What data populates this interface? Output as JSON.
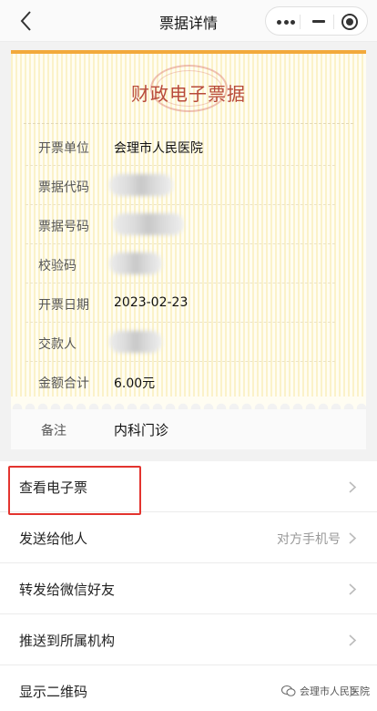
{
  "navbar": {
    "title": "票据详情",
    "back_icon": "chevron-left-icon"
  },
  "capsule": {
    "more_icon": "more-dots-icon",
    "minimize_icon": "minus-icon",
    "close_icon": "target-icon"
  },
  "receipt": {
    "title": "财政电子票据",
    "accent_color": "#f2a93b",
    "rows": [
      {
        "label": "开票单位",
        "value": "会理市人民医院"
      },
      {
        "label": "票据代码",
        "value": "",
        "masked": true
      },
      {
        "label": "票据号码",
        "value": "",
        "masked": true
      },
      {
        "label": "校验码",
        "value": "",
        "masked": true
      },
      {
        "label": "开票日期",
        "value": "2023-02-23"
      },
      {
        "label": "交款人",
        "value": "",
        "masked": true
      },
      {
        "label": "金额合计",
        "value": "6.00元"
      }
    ],
    "remark": {
      "label": "备注",
      "value": "内科门诊"
    }
  },
  "menu": [
    {
      "label": "查看电子票",
      "hint": ""
    },
    {
      "label": "发送给他人",
      "hint": "对方手机号"
    },
    {
      "label": "转发给微信好友",
      "hint": ""
    },
    {
      "label": "推送到所属机构",
      "hint": ""
    },
    {
      "label": "显示二维码",
      "hint": ""
    }
  ],
  "highlight_color": "#e3342f",
  "watermark": {
    "text": "会理市人民医院",
    "icon": "wechat-icon"
  }
}
